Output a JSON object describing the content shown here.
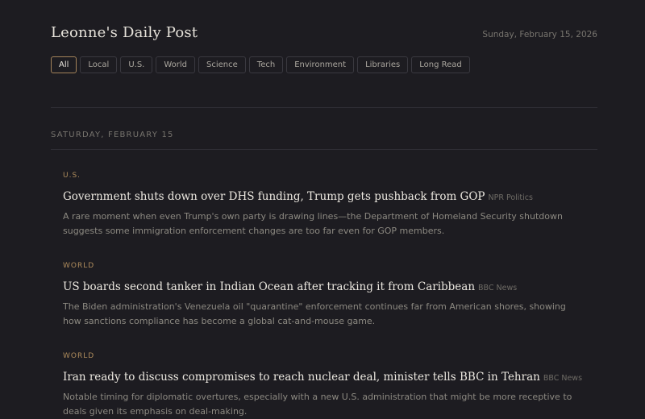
{
  "header": {
    "title": "Leonne's Daily Post",
    "date": "Sunday, February 15, 2026"
  },
  "filters": [
    {
      "label": "All",
      "active": true
    },
    {
      "label": "Local",
      "active": false
    },
    {
      "label": "U.S.",
      "active": false
    },
    {
      "label": "World",
      "active": false
    },
    {
      "label": "Science",
      "active": false
    },
    {
      "label": "Tech",
      "active": false
    },
    {
      "label": "Environment",
      "active": false
    },
    {
      "label": "Libraries",
      "active": false
    },
    {
      "label": "Long Read",
      "active": false
    }
  ],
  "day_heading": "SATURDAY, FEBRUARY 15",
  "articles": [
    {
      "category": "U.S.",
      "headline": "Government shuts down over DHS funding, Trump gets pushback from GOP",
      "source": "NPR Politics",
      "summary": "A rare moment when even Trump's own party is drawing lines—the Department of Homeland Security shutdown suggests some immigration enforcement changes are too far even for GOP members."
    },
    {
      "category": "WORLD",
      "headline": "US boards second tanker in Indian Ocean after tracking it from Caribbean",
      "source": "BBC News",
      "summary": "The Biden administration's Venezuela oil \"quarantine\" enforcement continues far from American shores, showing how sanctions compliance has become a global cat-and-mouse game."
    },
    {
      "category": "WORLD",
      "headline": "Iran ready to discuss compromises to reach nuclear deal, minister tells BBC in Tehran",
      "source": "BBC News",
      "summary": "Notable timing for diplomatic overtures, especially with a new U.S. administration that might be more receptive to deals given its emphasis on deal-making."
    }
  ]
}
